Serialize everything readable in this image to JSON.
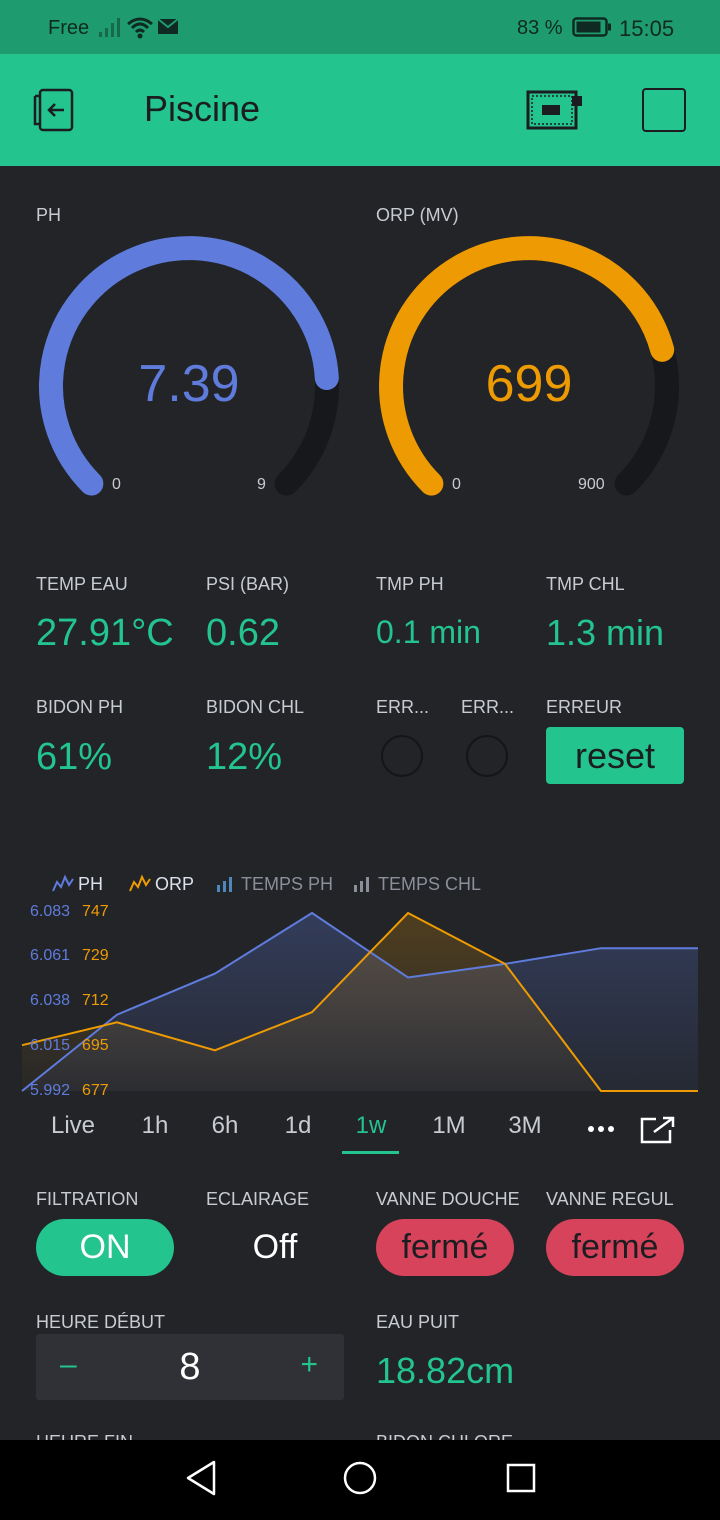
{
  "status_bar": {
    "carrier": "Free",
    "battery_pct": "83 %",
    "time": "15:05"
  },
  "header": {
    "title": "Piscine"
  },
  "gauges": [
    {
      "label": "PH",
      "value": "7.39",
      "min": "0",
      "max": "9",
      "fraction": 0.821,
      "color": "#5f7cdc"
    },
    {
      "label": "ORP (MV)",
      "value": "699",
      "min": "0",
      "max": "900",
      "fraction": 0.777,
      "color": "#ee9b03"
    }
  ],
  "values_row1": [
    {
      "label": "TEMP EAU",
      "value": "27.91°C"
    },
    {
      "label": "PSI (BAR)",
      "value": "0.62"
    },
    {
      "label": "TMP PH",
      "value": "0.1 min"
    },
    {
      "label": "TMP CHL",
      "value": "1.3 min"
    }
  ],
  "values_row2": [
    {
      "label": "BIDON PH",
      "value": "61%"
    },
    {
      "label": "BIDON CHL",
      "value": "12%"
    }
  ],
  "leds": [
    {
      "label": "ERR..."
    },
    {
      "label": "ERR..."
    }
  ],
  "error": {
    "label": "ERREUR",
    "button": "reset"
  },
  "chart_data": {
    "type": "area",
    "series": [
      {
        "name": "PH",
        "values": [
          5.992,
          6.031,
          6.052,
          6.083,
          6.05,
          6.057,
          6.065,
          6.065
        ],
        "color": "#5f7cdc"
      },
      {
        "name": "ORP",
        "values": [
          695,
          704,
          693,
          708,
          747,
          727,
          677,
          677
        ],
        "color": "#ee9b03"
      }
    ],
    "legend": [
      {
        "name": "PH",
        "color": "#5f7cdc",
        "icon": "line-icon"
      },
      {
        "name": "ORP",
        "color": "#ee9b03",
        "icon": "line-icon"
      },
      {
        "name": "TEMPS PH",
        "color": "#4f87b8",
        "icon": "bar-icon"
      },
      {
        "name": "TEMPS CHL",
        "color": "#8a8f99",
        "icon": "bar-icon"
      }
    ],
    "y_ticks_ph": [
      "6.083",
      "6.061",
      "6.038",
      "6.015",
      "5.992"
    ],
    "y_ticks_orp": [
      "747",
      "729",
      "712",
      "695",
      "677"
    ],
    "ph_range": [
      5.992,
      6.083
    ],
    "orp_range": [
      677,
      747
    ]
  },
  "periods": [
    "Live",
    "1h",
    "6h",
    "1d",
    "1w",
    "1M",
    "3M"
  ],
  "active_period": "1w",
  "switches": [
    {
      "label": "FILTRATION",
      "state": "ON"
    },
    {
      "label": "ECLAIRAGE",
      "state": "Off"
    },
    {
      "label": "VANNE DOUCHE",
      "state": "fermé"
    },
    {
      "label": "VANNE REGUL",
      "state": "fermé"
    }
  ],
  "start_hour": {
    "label": "HEURE DÉBUT",
    "value": "8",
    "minus": "–",
    "plus": "+"
  },
  "well_water": {
    "label": "EAU PUIT",
    "value": "18.82cm"
  },
  "cut_labels": [
    "HEURE FIN",
    "BIDON CHLORE"
  ]
}
